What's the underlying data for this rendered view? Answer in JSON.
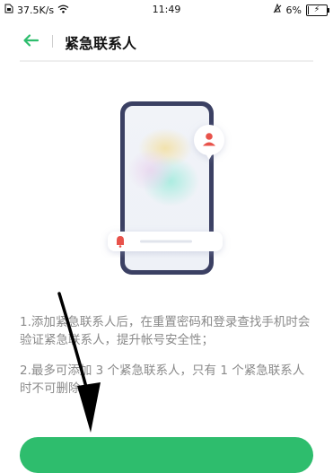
{
  "status_bar": {
    "speed": "37.5K/s",
    "time": "11:49",
    "battery_percent": "6%",
    "battery_level": 0.06,
    "icons": [
      "sim-icon",
      "wifi-icon",
      "alarm-icon",
      "battery-icon",
      "charging-icon"
    ]
  },
  "header": {
    "title": "紧急联系人",
    "back_icon": "arrow-left-icon"
  },
  "colors": {
    "accent": "#2ebd6d",
    "phone_frame": "#3b4063",
    "alert_red": "#e8524a"
  },
  "instructions": {
    "line1": "1.添加紧急联系人后，在重置密码和登录查找手机时会验证紧急联系人，提升帐号安全性；",
    "line2": "2.最多可添加 3 个紧急联系人，只有 1 个紧急联系人时不可删除。"
  }
}
